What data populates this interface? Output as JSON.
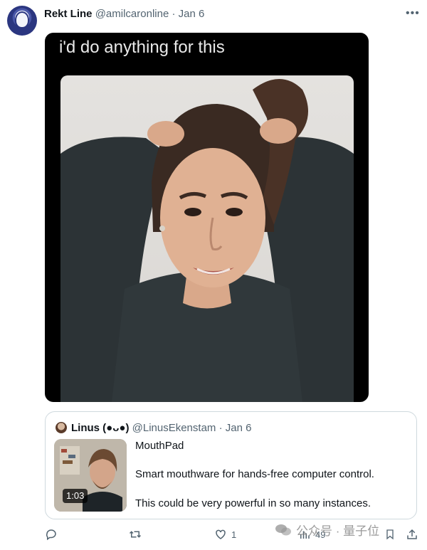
{
  "tweet": {
    "display_name": "Rekt Line",
    "handle": "@amilcaronline",
    "separator": "·",
    "date": "Jan 6",
    "media_caption": "i'd do anything for this"
  },
  "quoted_tweet": {
    "display_name": "Linus (●ᴗ●)",
    "handle": "@LinusEkenstam",
    "separator": "·",
    "date": "Jan 6",
    "video_duration": "1:03",
    "title": "MouthPad",
    "line1": "Smart mouthware for hands-free computer control.",
    "line2": "This could be very powerful in so many instances."
  },
  "actions": {
    "reply_icon": "reply-icon",
    "retweet_icon": "retweet-icon",
    "like_icon": "heart-icon",
    "like_count": "1",
    "views_icon": "views-icon",
    "views_count": "49",
    "bookmark_icon": "bookmark-icon",
    "share_icon": "share-icon"
  },
  "watermark": {
    "text": "公众号 · 量子位"
  },
  "colors": {
    "text": "#0f1419",
    "muted": "#536471",
    "border": "#cfd9de",
    "media_bg": "#000000"
  }
}
